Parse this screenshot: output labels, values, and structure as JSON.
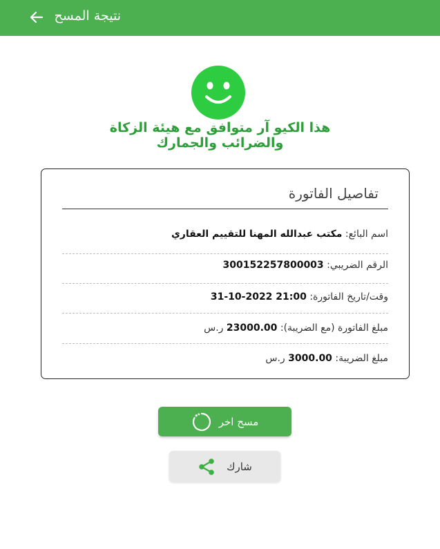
{
  "app_bar": {
    "title": "نتيجة المسح",
    "back_icon": "arrow-left-icon"
  },
  "status": {
    "icon": "smiley-icon",
    "message_line1": "هذا الكيو آر متوافق مع هيئة الزكاة",
    "message_line2": "والضرائب والجمارك"
  },
  "invoice": {
    "title": "تفاصيل الفاتورة",
    "rows": [
      {
        "label": "اسم البائع:",
        "value": "مكتب عبدالله المهنا للتقييم العقاري",
        "suffix": ""
      },
      {
        "label": "الرقم الضريبي:",
        "value": "300152257800003",
        "suffix": ""
      },
      {
        "label": "وقت/تاريخ الفاتورة:",
        "value": "31-10-2022 21:00",
        "suffix": ""
      },
      {
        "label": "مبلغ الفاتورة (مع الضريبة):",
        "value": "23000.00",
        "suffix": "ر.س"
      },
      {
        "label": "مبلغ الضريبة:",
        "value": "3000.00",
        "suffix": "ر.س"
      }
    ]
  },
  "actions": {
    "rescan_label": "مسح اخر",
    "rescan_icon": "refresh-icon",
    "share_label": "شارك",
    "share_icon": "share-icon"
  },
  "colors": {
    "primary": "#4caf50",
    "status_text": "#2e9e3a"
  }
}
